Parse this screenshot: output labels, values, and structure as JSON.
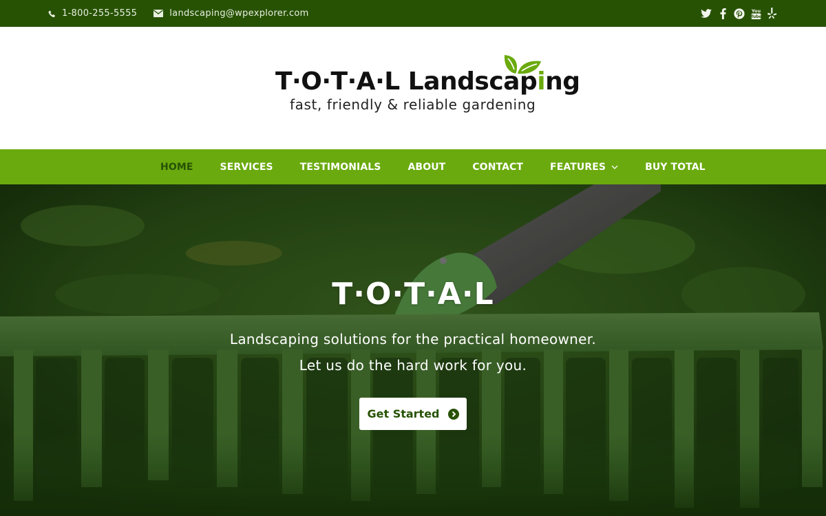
{
  "topbar": {
    "phone": "1-800-255-5555",
    "email": "landscaping@wpexplorer.com",
    "social": [
      {
        "name": "twitter-icon"
      },
      {
        "name": "facebook-icon"
      },
      {
        "name": "pinterest-icon"
      },
      {
        "name": "youtube-icon"
      },
      {
        "name": "yelp-icon"
      }
    ]
  },
  "logo": {
    "title_main": "T·O·T·A·L Landscap",
    "title_accent": "i",
    "title_end": "ng",
    "tagline": "fast, friendly & reliable gardening"
  },
  "nav": {
    "items": [
      {
        "label": "HOME",
        "active": true
      },
      {
        "label": "SERVICES"
      },
      {
        "label": "TESTIMONIALS"
      },
      {
        "label": "ABOUT"
      },
      {
        "label": "CONTACT"
      },
      {
        "label": "FEATURES",
        "has_dropdown": true
      },
      {
        "label": "BUY TOTAL"
      }
    ]
  },
  "hero": {
    "title": "T·O·T·A·L",
    "subtitle_line1": "Landscaping solutions for the practical homeowner.",
    "subtitle_line2": "Let us do the hard work for you.",
    "cta_label": "Get Started"
  },
  "colors": {
    "topbar_bg": "#275204",
    "nav_bg": "#6aaa0e",
    "accent": "#6aaa0e",
    "nav_active": "#275204"
  }
}
